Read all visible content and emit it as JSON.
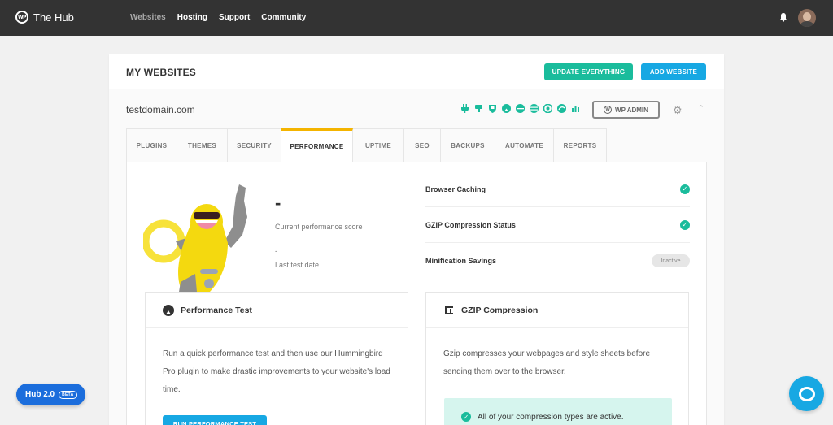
{
  "app": {
    "name": "The Hub",
    "logo_mark": "WP"
  },
  "nav": {
    "items": [
      "Websites",
      "Hosting",
      "Support",
      "Community"
    ]
  },
  "header_icons": {
    "notifications": "bell-icon",
    "user": "avatar"
  },
  "main": {
    "title": "MY WEBSITES",
    "update_label": "UPDATE EVERYTHING",
    "add_label": "ADD WEBSITE"
  },
  "site": {
    "domain": "testdomain.com",
    "wp_admin_label": "WP ADMIN",
    "status_icons": [
      "plugin-icon",
      "plugin-icon",
      "shield-icon",
      "performance-icon",
      "uptime-icon",
      "seo-icon",
      "backup-icon",
      "automate-icon",
      "reports-icon"
    ]
  },
  "tabs": [
    "PLUGINS",
    "THEMES",
    "SECURITY",
    "PERFORMANCE",
    "UPTIME",
    "SEO",
    "BACKUPS",
    "AUTOMATE",
    "REPORTS"
  ],
  "active_tab": "PERFORMANCE",
  "performance": {
    "score": "-",
    "score_label": "Current performance score",
    "last_test": "-",
    "last_test_label": "Last test date",
    "checks": [
      {
        "label": "Browser Caching",
        "status": "✓"
      },
      {
        "label": "GZIP Compression Status",
        "status": "✓"
      },
      {
        "label": "Minification Savings",
        "status": "Inactive"
      }
    ]
  },
  "perf_test": {
    "title": "Performance Test",
    "body": "Run a quick performance test and then use our Hummingbird Pro plugin to make drastic improvements to your website's load time.",
    "button": "RUN PERFORMANCE TEST"
  },
  "gzip": {
    "title": "GZIP Compression",
    "body": "Gzip compresses your webpages and style sheets before sending them over to the browser.",
    "notice": "All of your compression types are active."
  },
  "hub_badge": {
    "label": "Hub 2.0",
    "beta": "BETA"
  },
  "colors": {
    "topbar": "#333333",
    "green": "#1abc9c",
    "blue": "#17a8e3",
    "accent_tab": "#f4b400",
    "hub_blue": "#1b6ddc"
  }
}
